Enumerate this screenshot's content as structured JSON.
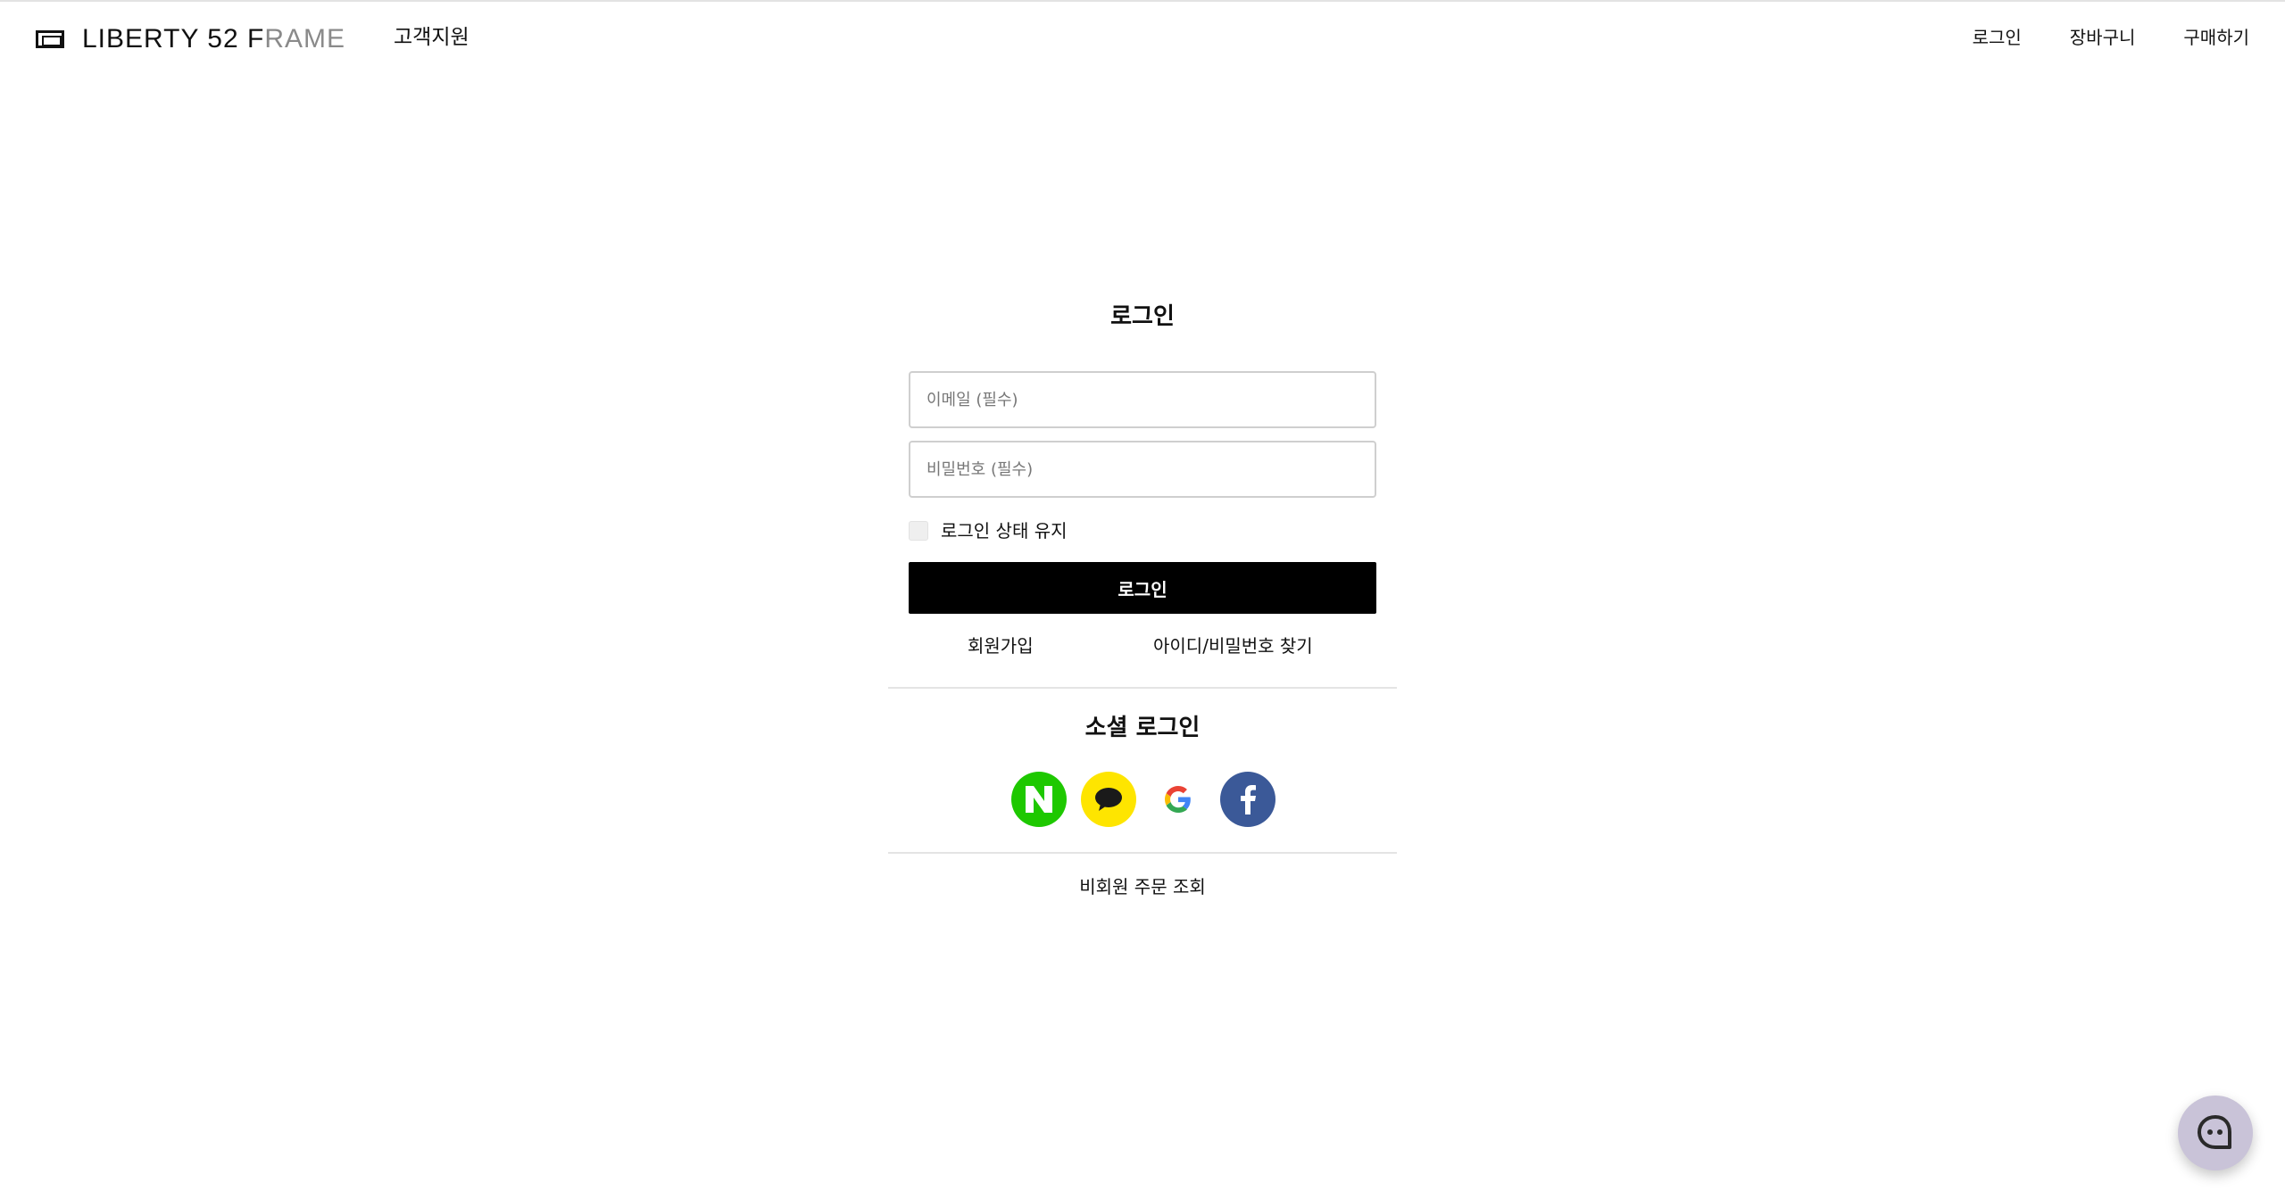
{
  "header": {
    "logo": {
      "icon": "frame-logo-icon",
      "text_dark": "LIBERTY 52 F",
      "text_light": "RAME"
    },
    "support_label": "고객지원",
    "nav": [
      {
        "label": "로그인"
      },
      {
        "label": "장바구니"
      },
      {
        "label": "구매하기"
      }
    ]
  },
  "login": {
    "title": "로그인",
    "email_placeholder": "이메일 (필수)",
    "password_placeholder": "비밀번호 (필수)",
    "keep_label": "로그인 상태 유지",
    "submit_label": "로그인",
    "signup_label": "회원가입",
    "find_label": "아이디/비밀번호 찾기"
  },
  "social": {
    "title": "소셜 로그인",
    "providers": [
      {
        "name": "naver",
        "icon": "naver-icon",
        "color": "#1ec800"
      },
      {
        "name": "kakao",
        "icon": "kakao-icon",
        "color": "#fee500"
      },
      {
        "name": "google",
        "icon": "google-icon",
        "color": "#ffffff"
      },
      {
        "name": "facebook",
        "icon": "facebook-icon",
        "color": "#3b5998"
      }
    ]
  },
  "guest_order_label": "비회원 주문 조회",
  "chat": {
    "icon": "chat-bot-icon",
    "color": "#c9c3d8"
  }
}
